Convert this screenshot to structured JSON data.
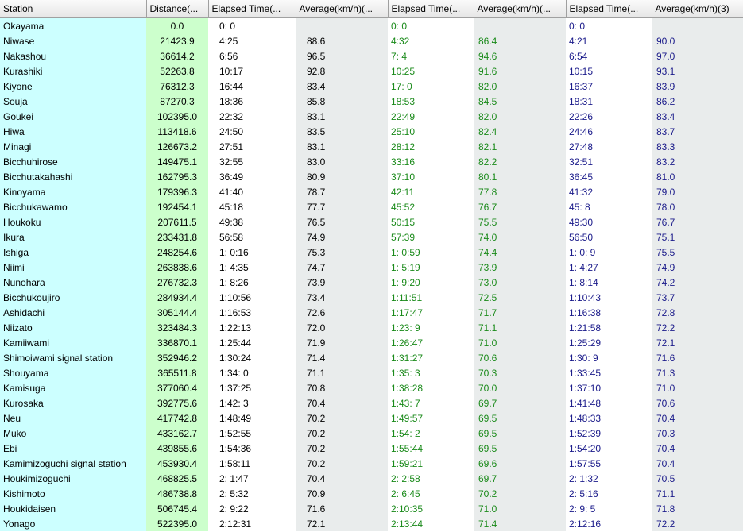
{
  "headers": [
    "Station",
    "Distance(...",
    "Elapsed Time(...",
    "Average(km/h)(...",
    "Elapsed Time(...",
    "Average(km/h)(...",
    "Elapsed Time(...",
    "Average(km/h)(3)"
  ],
  "rows": [
    [
      "Okayama",
      "0.0",
      "0: 0",
      "",
      "0: 0",
      "",
      "0: 0",
      ""
    ],
    [
      "Niwase",
      "21423.9",
      "4:25",
      "88.6",
      "4:32",
      "86.4",
      "4:21",
      "90.0"
    ],
    [
      "Nakashou",
      "36614.2",
      "6:56",
      "96.5",
      "7: 4",
      "94.6",
      "6:54",
      "97.0"
    ],
    [
      "Kurashiki",
      "52263.8",
      "10:17",
      "92.8",
      "10:25",
      "91.6",
      "10:15",
      "93.1"
    ],
    [
      "Kiyone",
      "76312.3",
      "16:44",
      "83.4",
      "17: 0",
      "82.0",
      "16:37",
      "83.9"
    ],
    [
      "Souja",
      "87270.3",
      "18:36",
      "85.8",
      "18:53",
      "84.5",
      "18:31",
      "86.2"
    ],
    [
      "Goukei",
      "102395.0",
      "22:32",
      "83.1",
      "22:49",
      "82.0",
      "22:26",
      "83.4"
    ],
    [
      "Hiwa",
      "113418.6",
      "24:50",
      "83.5",
      "25:10",
      "82.4",
      "24:46",
      "83.7"
    ],
    [
      "Minagi",
      "126673.2",
      "27:51",
      "83.1",
      "28:12",
      "82.1",
      "27:48",
      "83.3"
    ],
    [
      "Bicchuhirose",
      "149475.1",
      "32:55",
      "83.0",
      "33:16",
      "82.2",
      "32:51",
      "83.2"
    ],
    [
      "Bicchutakahashi",
      "162795.3",
      "36:49",
      "80.9",
      "37:10",
      "80.1",
      "36:45",
      "81.0"
    ],
    [
      "Kinoyama",
      "179396.3",
      "41:40",
      "78.7",
      "42:11",
      "77.8",
      "41:32",
      "79.0"
    ],
    [
      "Bicchukawamo",
      "192454.1",
      "45:18",
      "77.7",
      "45:52",
      "76.7",
      "45: 8",
      "78.0"
    ],
    [
      "Houkoku",
      "207611.5",
      "49:38",
      "76.5",
      "50:15",
      "75.5",
      "49:30",
      "76.7"
    ],
    [
      "Ikura",
      "233431.8",
      "56:58",
      "74.9",
      "57:39",
      "74.0",
      "56:50",
      "75.1"
    ],
    [
      "Ishiga",
      "248254.6",
      "1: 0:16",
      "75.3",
      "1: 0:59",
      "74.4",
      "1: 0: 9",
      "75.5"
    ],
    [
      "Niimi",
      "263838.6",
      "1: 4:35",
      "74.7",
      "1: 5:19",
      "73.9",
      "1: 4:27",
      "74.9"
    ],
    [
      "Nunohara",
      "276732.3",
      "1: 8:26",
      "73.9",
      "1: 9:20",
      "73.0",
      "1: 8:14",
      "74.2"
    ],
    [
      "Bicchukoujiro",
      "284934.4",
      "1:10:56",
      "73.4",
      "1:11:51",
      "72.5",
      "1:10:43",
      "73.7"
    ],
    [
      "Ashidachi",
      "305144.4",
      "1:16:53",
      "72.6",
      "1:17:47",
      "71.7",
      "1:16:38",
      "72.8"
    ],
    [
      "Niizato",
      "323484.3",
      "1:22:13",
      "72.0",
      "1:23: 9",
      "71.1",
      "1:21:58",
      "72.2"
    ],
    [
      "Kamiiwami",
      "336870.1",
      "1:25:44",
      "71.9",
      "1:26:47",
      "71.0",
      "1:25:29",
      "72.1"
    ],
    [
      "Shimoiwami signal station",
      "352946.2",
      "1:30:24",
      "71.4",
      "1:31:27",
      "70.6",
      "1:30: 9",
      "71.6"
    ],
    [
      "Shouyama",
      "365511.8",
      "1:34: 0",
      "71.1",
      "1:35: 3",
      "70.3",
      "1:33:45",
      "71.3"
    ],
    [
      "Kamisuga",
      "377060.4",
      "1:37:25",
      "70.8",
      "1:38:28",
      "70.0",
      "1:37:10",
      "71.0"
    ],
    [
      "Kurosaka",
      "392775.6",
      "1:42: 3",
      "70.4",
      "1:43: 7",
      "69.7",
      "1:41:48",
      "70.6"
    ],
    [
      "Neu",
      "417742.8",
      "1:48:49",
      "70.2",
      "1:49:57",
      "69.5",
      "1:48:33",
      "70.4"
    ],
    [
      "Muko",
      "433162.7",
      "1:52:55",
      "70.2",
      "1:54: 2",
      "69.5",
      "1:52:39",
      "70.3"
    ],
    [
      "Ebi",
      "439855.6",
      "1:54:36",
      "70.2",
      "1:55:44",
      "69.5",
      "1:54:20",
      "70.4"
    ],
    [
      "Kamimizoguchi signal station",
      "453930.4",
      "1:58:11",
      "70.2",
      "1:59:21",
      "69.6",
      "1:57:55",
      "70.4"
    ],
    [
      "Houkimizoguchi",
      "468825.5",
      "2: 1:47",
      "70.4",
      "2: 2:58",
      "69.7",
      "2: 1:32",
      "70.5"
    ],
    [
      "Kishimoto",
      "486738.8",
      "2: 5:32",
      "70.9",
      "2: 6:45",
      "70.2",
      "2: 5:16",
      "71.1"
    ],
    [
      "Houkidaisen",
      "506745.4",
      "2: 9:22",
      "71.6",
      "2:10:35",
      "71.0",
      "2: 9: 5",
      "71.8"
    ],
    [
      "Yonago",
      "522395.0",
      "2:12:31",
      "72.1",
      "2:13:44",
      "71.4",
      "2:12:16",
      "72.2"
    ]
  ]
}
